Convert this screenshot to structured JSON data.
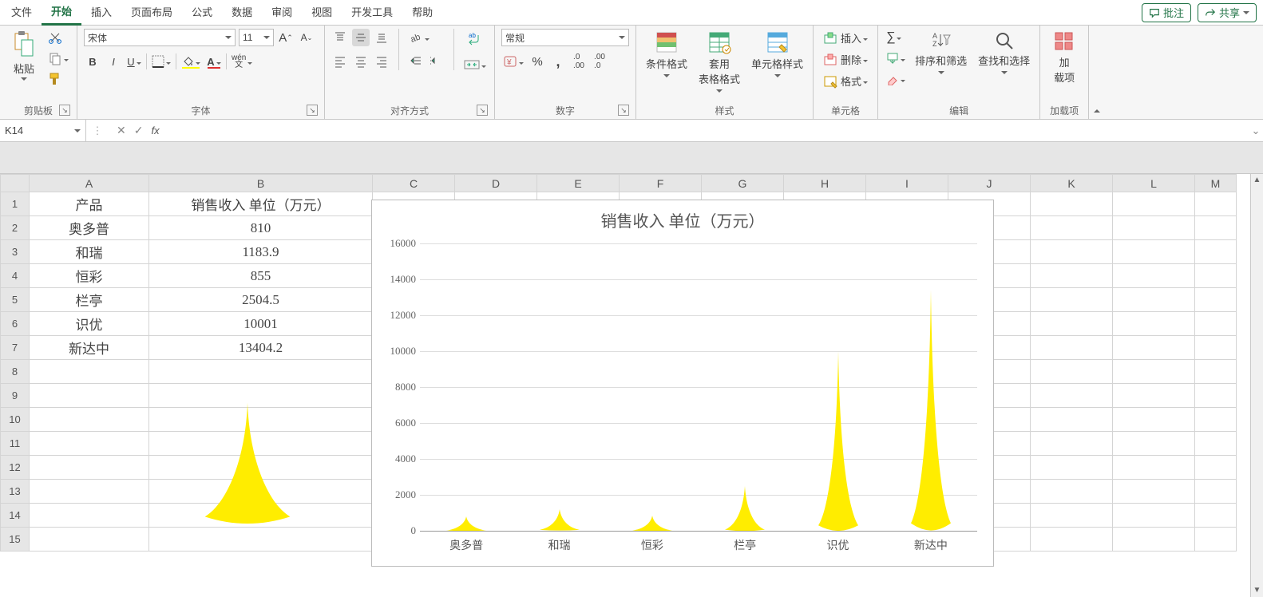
{
  "tabs": {
    "items": [
      "文件",
      "开始",
      "插入",
      "页面布局",
      "公式",
      "数据",
      "审阅",
      "视图",
      "开发工具",
      "帮助"
    ],
    "active": 1
  },
  "topright": {
    "comment": "批注",
    "share": "共享"
  },
  "ribbon": {
    "clipboard": {
      "label": "剪贴板",
      "paste": "粘贴"
    },
    "font": {
      "label": "字体",
      "name": "宋体",
      "size": "11"
    },
    "align": {
      "label": "对齐方式"
    },
    "number": {
      "label": "数字",
      "format": "常规"
    },
    "styles": {
      "label": "样式",
      "cond": "条件格式",
      "table": "套用\n表格格式",
      "cell": "单元格样式"
    },
    "cells": {
      "label": "单元格",
      "insert": "插入",
      "delete": "删除",
      "format": "格式"
    },
    "editing": {
      "label": "编辑",
      "sort": "排序和筛选",
      "find": "查找和选择"
    },
    "addins": {
      "label": "加载项",
      "btn": "加\n载项"
    }
  },
  "namebox": "K14",
  "columns": [
    "A",
    "B",
    "C",
    "D",
    "E",
    "F",
    "G",
    "H",
    "I",
    "J",
    "K",
    "L",
    "M"
  ],
  "rows": [
    1,
    2,
    3,
    4,
    5,
    6,
    7,
    8,
    9,
    10,
    11,
    12,
    13,
    14,
    15
  ],
  "table": {
    "headers": [
      "产品",
      "销售收入 单位（万元）"
    ],
    "data": [
      [
        "奥多普",
        "810"
      ],
      [
        "和瑞",
        "1183.9"
      ],
      [
        "恒彩",
        "855"
      ],
      [
        "栏亭",
        "2504.5"
      ],
      [
        "识优",
        "10001"
      ],
      [
        "新达中",
        "13404.2"
      ]
    ]
  },
  "chart_data": {
    "type": "bar",
    "title": "销售收入 单位（万元）",
    "categories": [
      "奥多普",
      "和瑞",
      "恒彩",
      "栏亭",
      "识优",
      "新达中"
    ],
    "values": [
      810,
      1183.9,
      855,
      2504.5,
      10001,
      13404.2
    ],
    "ylim": [
      0,
      16000
    ],
    "ytick": 2000,
    "xlabel": "",
    "ylabel": ""
  }
}
